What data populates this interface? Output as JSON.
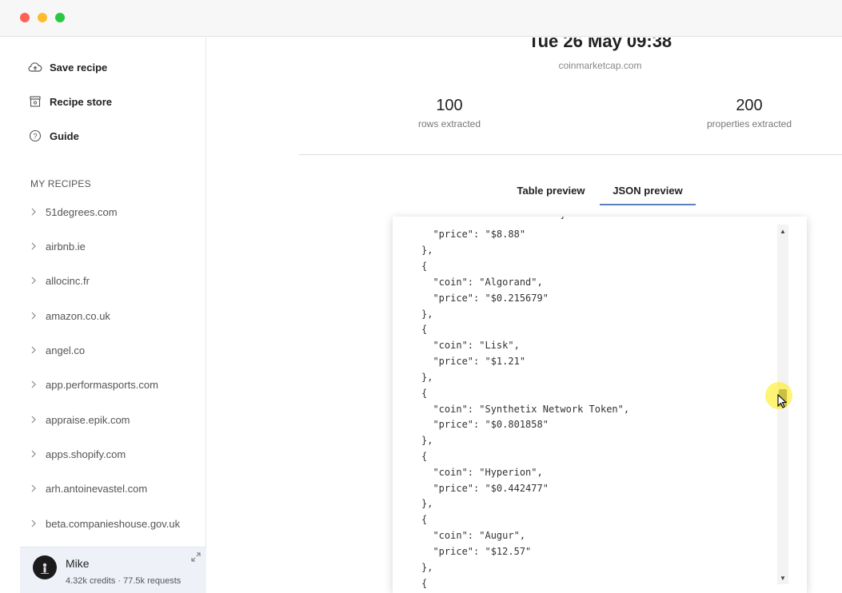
{
  "sidebar": {
    "actions": [
      {
        "label": "Save recipe",
        "icon": "cloud-upload-icon"
      },
      {
        "label": "Recipe store",
        "icon": "store-icon"
      },
      {
        "label": "Guide",
        "icon": "help-circle-icon"
      }
    ],
    "section_label": "MY RECIPES",
    "recipes": [
      "51degrees.com",
      "airbnb.ie",
      "allocinc.fr",
      "amazon.co.uk",
      "angel.co",
      "app.performasports.com",
      "appraise.epik.com",
      "apps.shopify.com",
      "arh.antoinevastel.com",
      "beta.companieshouse.gov.uk"
    ]
  },
  "user": {
    "name": "Mike",
    "meta": "4.32k credits · 77.5k requests"
  },
  "summary": {
    "date": "Tue 26 May 09:38",
    "source": "coinmarketcap.com",
    "rows_value": "100",
    "rows_label": "rows extracted",
    "props_value": "200",
    "props_label": "properties extracted"
  },
  "tabs": {
    "table": "Table preview",
    "json": "JSON preview",
    "active": "json"
  },
  "json_preview": {
    "lines": [
      "},",
      "{",
      "  \"coin\": \"Algorand\",",
      "  \"price\": \"$0.215679\"",
      "},",
      "{",
      "  \"coin\": \"Lisk\",",
      "  \"price\": \"$1.21\"",
      "},",
      "{",
      "  \"coin\": \"Synthetix Network Token\",",
      "  \"price\": \"$0.801858\"",
      "},",
      "{",
      "  \"coin\": \"Hyperion\",",
      "  \"price\": \"$0.442477\"",
      "},",
      "{",
      "  \"coin\": \"Augur\",",
      "  \"price\": \"$12.57\"",
      "},"
    ],
    "first_line": "  \"price\": \"$8.88\""
  },
  "colors": {
    "accent": "#5b7fbf",
    "user_bg": "#eef2f8",
    "cursor_highlight": "#ffeb00"
  }
}
